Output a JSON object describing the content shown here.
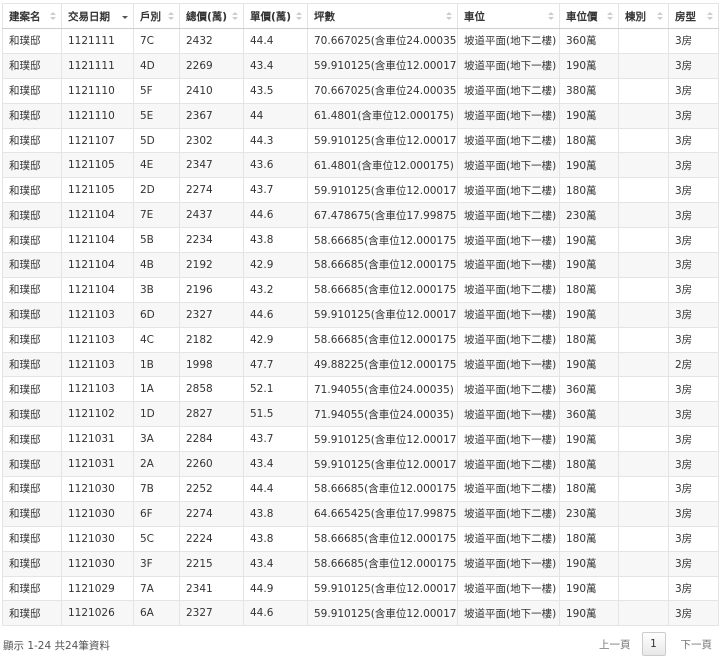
{
  "table": {
    "columns": [
      {
        "label": "建案名",
        "sort": "both"
      },
      {
        "label": "交易日期",
        "sort": "desc"
      },
      {
        "label": "戶別",
        "sort": "both"
      },
      {
        "label": "總價(萬)",
        "sort": "both"
      },
      {
        "label": "單價(萬)",
        "sort": "both"
      },
      {
        "label": "坪數",
        "sort": "both"
      },
      {
        "label": "車位",
        "sort": "both"
      },
      {
        "label": "車位價",
        "sort": "both"
      },
      {
        "label": "棟別",
        "sort": "both"
      },
      {
        "label": "房型",
        "sort": "both"
      }
    ],
    "rows": [
      [
        "和璞邸",
        "1121111",
        "7C",
        "2432",
        "44.4",
        "70.667025(含車位24.00035)",
        "坡道平面(地下二樓)",
        "360萬",
        "",
        "3房"
      ],
      [
        "和璞邸",
        "1121111",
        "4D",
        "2269",
        "43.4",
        "59.910125(含車位12.000175)",
        "坡道平面(地下一樓)",
        "190萬",
        "",
        "3房"
      ],
      [
        "和璞邸",
        "1121110",
        "5F",
        "2410",
        "43.5",
        "70.667025(含車位24.00035)",
        "坡道平面(地下二樓)",
        "380萬",
        "",
        "3房"
      ],
      [
        "和璞邸",
        "1121110",
        "5E",
        "2367",
        "44",
        "61.4801(含車位12.000175)",
        "坡道平面(地下一樓)",
        "190萬",
        "",
        "3房"
      ],
      [
        "和璞邸",
        "1121107",
        "5D",
        "2302",
        "44.3",
        "59.910125(含車位12.000175)",
        "坡道平面(地下二樓)",
        "180萬",
        "",
        "3房"
      ],
      [
        "和璞邸",
        "1121105",
        "4E",
        "2347",
        "43.6",
        "61.4801(含車位12.000175)",
        "坡道平面(地下一樓)",
        "190萬",
        "",
        "3房"
      ],
      [
        "和璞邸",
        "1121105",
        "2D",
        "2274",
        "43.7",
        "59.910125(含車位12.000175)",
        "坡道平面(地下二樓)",
        "180萬",
        "",
        "3房"
      ],
      [
        "和璞邸",
        "1121104",
        "7E",
        "2437",
        "44.6",
        "67.478675(含車位17.99875)",
        "坡道平面(地下二樓)",
        "230萬",
        "",
        "3房"
      ],
      [
        "和璞邸",
        "1121104",
        "5B",
        "2234",
        "43.8",
        "58.66685(含車位12.000175)",
        "坡道平面(地下一樓)",
        "190萬",
        "",
        "3房"
      ],
      [
        "和璞邸",
        "1121104",
        "4B",
        "2192",
        "42.9",
        "58.66685(含車位12.000175)",
        "坡道平面(地下一樓)",
        "190萬",
        "",
        "3房"
      ],
      [
        "和璞邸",
        "1121104",
        "3B",
        "2196",
        "43.2",
        "58.66685(含車位12.000175)",
        "坡道平面(地下二樓)",
        "180萬",
        "",
        "3房"
      ],
      [
        "和璞邸",
        "1121103",
        "6D",
        "2327",
        "44.6",
        "59.910125(含車位12.000175)",
        "坡道平面(地下一樓)",
        "190萬",
        "",
        "3房"
      ],
      [
        "和璞邸",
        "1121103",
        "4C",
        "2182",
        "42.9",
        "58.66685(含車位12.000175)",
        "坡道平面(地下二樓)",
        "180萬",
        "",
        "3房"
      ],
      [
        "和璞邸",
        "1121103",
        "1B",
        "1998",
        "47.7",
        "49.88225(含車位12.000175)",
        "坡道平面(地下一樓)",
        "190萬",
        "",
        "2房"
      ],
      [
        "和璞邸",
        "1121103",
        "1A",
        "2858",
        "52.1",
        "71.94055(含車位24.00035)",
        "坡道平面(地下二樓)",
        "360萬",
        "",
        "3房"
      ],
      [
        "和璞邸",
        "1121102",
        "1D",
        "2827",
        "51.5",
        "71.94055(含車位24.00035)",
        "坡道平面(地下一樓)",
        "360萬",
        "",
        "3房"
      ],
      [
        "和璞邸",
        "1121031",
        "3A",
        "2284",
        "43.7",
        "59.910125(含車位12.000175)",
        "坡道平面(地下一樓)",
        "190萬",
        "",
        "3房"
      ],
      [
        "和璞邸",
        "1121031",
        "2A",
        "2260",
        "43.4",
        "59.910125(含車位12.000175)",
        "坡道平面(地下二樓)",
        "180萬",
        "",
        "3房"
      ],
      [
        "和璞邸",
        "1121030",
        "7B",
        "2252",
        "44.4",
        "58.66685(含車位12.000175)",
        "坡道平面(地下二樓)",
        "180萬",
        "",
        "3房"
      ],
      [
        "和璞邸",
        "1121030",
        "6F",
        "2274",
        "43.8",
        "64.665425(含車位17.99875)",
        "坡道平面(地下二樓)",
        "230萬",
        "",
        "3房"
      ],
      [
        "和璞邸",
        "1121030",
        "5C",
        "2224",
        "43.8",
        "58.66685(含車位12.000175)",
        "坡道平面(地下二樓)",
        "180萬",
        "",
        "3房"
      ],
      [
        "和璞邸",
        "1121030",
        "3F",
        "2215",
        "43.4",
        "58.66685(含車位12.000175)",
        "坡道平面(地下一樓)",
        "190萬",
        "",
        "3房"
      ],
      [
        "和璞邸",
        "1121029",
        "7A",
        "2341",
        "44.9",
        "59.910125(含車位12.000175)",
        "坡道平面(地下一樓)",
        "190萬",
        "",
        "3房"
      ],
      [
        "和璞邸",
        "1121026",
        "6A",
        "2327",
        "44.6",
        "59.910125(含車位12.000175)",
        "坡道平面(地下一樓)",
        "190萬",
        "",
        "3房"
      ]
    ]
  },
  "footer": {
    "info": "顯示 1-24 共24筆資料"
  },
  "pagination": {
    "prev": "上一頁",
    "current": "1",
    "next": "下一頁"
  }
}
